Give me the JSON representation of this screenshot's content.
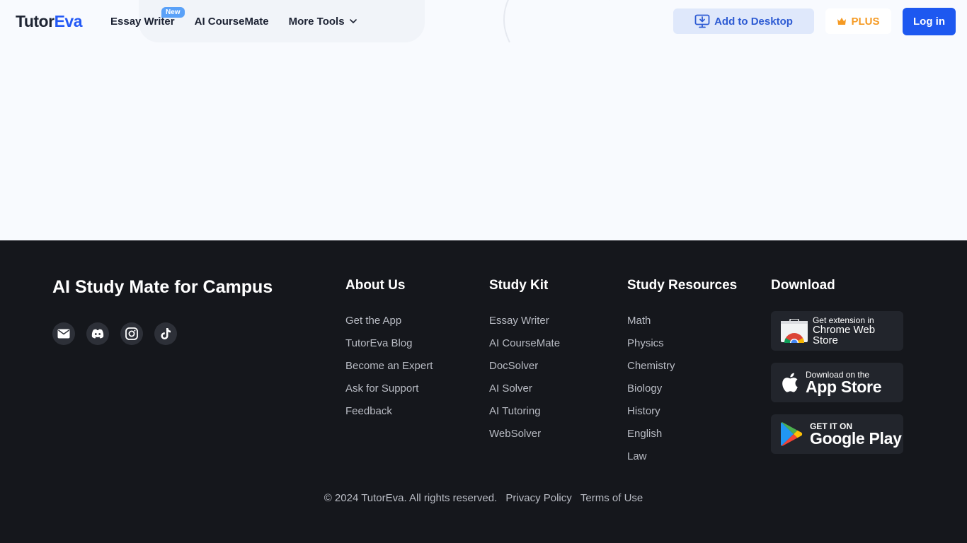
{
  "header": {
    "logo": {
      "part1": "Tutor",
      "part2": "Eva"
    },
    "nav": [
      {
        "label": "Essay Writer",
        "badge": "New"
      },
      {
        "label": "AI CourseMate"
      },
      {
        "label": "More Tools"
      }
    ],
    "add_to_desktop_label": "Add to Desktop",
    "plus_label": "PLUS",
    "login_label": "Log in"
  },
  "footer": {
    "tagline": "AI Study Mate for Campus",
    "socials": [
      "mail-icon",
      "discord-icon",
      "instagram-icon",
      "tiktok-icon"
    ],
    "columns": [
      {
        "title": "About Us",
        "items": [
          "Get the App",
          "TutorEva Blog",
          "Become an Expert",
          "Ask for Support",
          "Feedback"
        ]
      },
      {
        "title": "Study Kit",
        "items": [
          "Essay Writer",
          "AI CourseMate",
          "DocSolver",
          "AI Solver",
          "AI Tutoring",
          "WebSolver"
        ]
      },
      {
        "title": "Study Resources",
        "items": [
          "Math",
          "Physics",
          "Chemistry",
          "Biology",
          "History",
          "English",
          "Law"
        ]
      }
    ],
    "download": {
      "title": "Download",
      "chrome": {
        "line1": "Get extension in",
        "line2": "Chrome Web Store"
      },
      "appstore": {
        "line1": "Download on the",
        "line2": "App Store"
      },
      "googleplay": {
        "line1": "GET IT ON",
        "line2": "Google Play"
      }
    },
    "copyright": "© 2024 TutorEva. All rights reserved.",
    "privacy_label": "Privacy Policy",
    "terms_label": "Terms of Use"
  },
  "colors": {
    "accent": "#1d58f0",
    "footer_bg": "#15171c",
    "page_bg": "#f8fafe",
    "plus": "#f59a23"
  }
}
